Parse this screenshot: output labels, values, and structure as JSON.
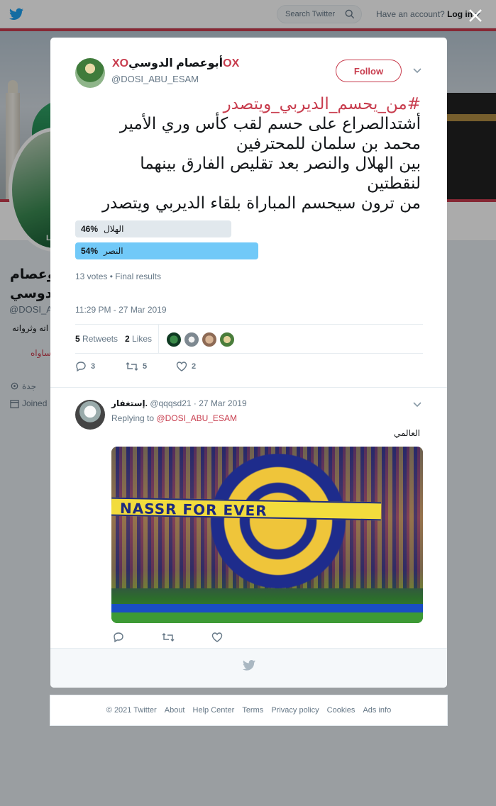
{
  "colors": {
    "accent": "#c83d4e",
    "twitter_blue": "#1da1f2",
    "poll_winner": "#71c9f8",
    "poll_loser": "#e1e8ed",
    "text_secondary": "#657786"
  },
  "topbar": {
    "search_placeholder": "Search Twitter",
    "account_prompt": "Have an account?",
    "login_label": "Log in"
  },
  "background_profile": {
    "name_line1": "ابوعصام",
    "name_line2": "الدوسي",
    "handle": "@DOSI_A",
    "bio": "اته وثرواته",
    "link": "ساواه",
    "location": "جدة",
    "joined": "Joined"
  },
  "tweet": {
    "author_name": "أبوعصام الدوسي",
    "author_handle": "@DOSI_ABU_ESAM",
    "follow_label": "Follow",
    "hashtag": "#من_يحسم_الديربي_ويتصدر",
    "lines": [
      "أشتدالصراع على حسم لقب كأس وري الأمير",
      "محمد بن سلمان للمحترفين",
      "بين الهلال والنصر بعد تقليص الفارق بينهما",
      "لنقطتين",
      "من ترون سيحسم المباراة بلقاء الديربي ويتصدر"
    ],
    "poll": {
      "options": [
        {
          "label": "الهلال",
          "percent": 46,
          "percent_text": "46%",
          "winner": false
        },
        {
          "label": "النصر",
          "percent": 54,
          "percent_text": "54%",
          "winner": true
        }
      ],
      "votes": "13 votes",
      "status": "Final results"
    },
    "timestamp": "11:29 PM - 27 Mar 2019",
    "retweets_count": "5",
    "retweets_label": "Retweets",
    "likes_count": "2",
    "likes_label": "Likes",
    "actions": {
      "replies": "3",
      "retweets": "5",
      "likes": "2"
    }
  },
  "reply": {
    "author_name": "إستغفار.",
    "author_handle": "@qqqsd21",
    "date": "27 Mar 2019",
    "replying_prefix": "Replying to",
    "replying_to": "@DOSI_ABU_ESAM",
    "text": "العالمي",
    "image_banner_text": "NASSR FOR EVER"
  },
  "footer": {
    "links": [
      "© 2021 Twitter",
      "About",
      "Help Center",
      "Terms",
      "Privacy policy",
      "Cookies",
      "Ads info"
    ]
  }
}
